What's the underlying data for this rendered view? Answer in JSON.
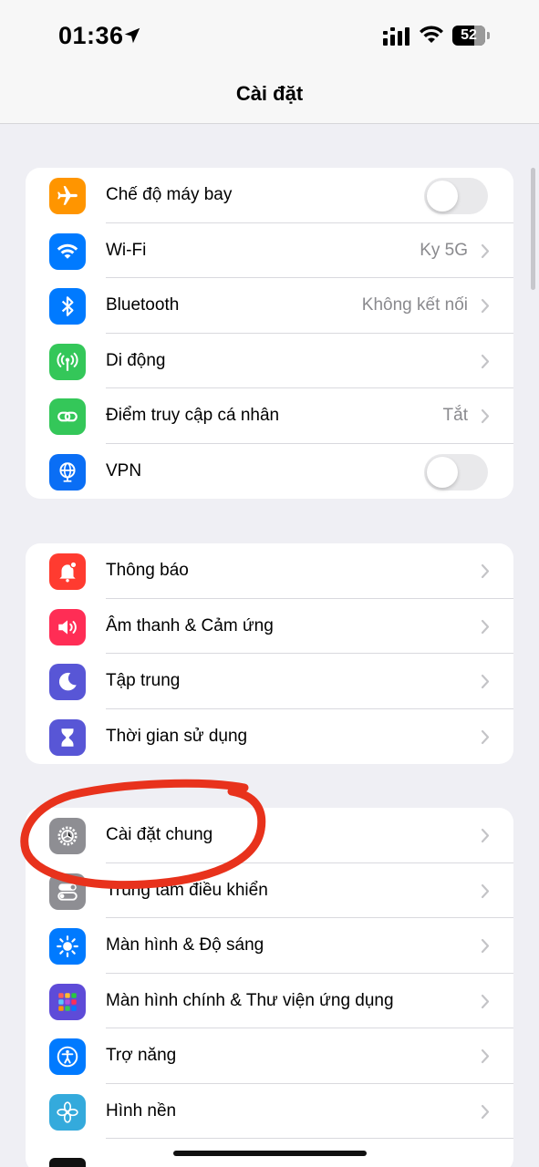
{
  "status_bar": {
    "time": "01:36",
    "battery": "52",
    "icons": [
      "location-arrow-icon",
      "cellular-signal-icon",
      "wifi-icon",
      "battery-icon"
    ]
  },
  "nav": {
    "title": "Cài đặt"
  },
  "groups": [
    {
      "items": [
        {
          "label": "Chế độ máy bay",
          "icon": "airplane-icon",
          "color": "#ff9500",
          "type": "toggle",
          "on": false
        },
        {
          "label": "Wi-Fi",
          "icon": "wifi-icon",
          "color": "#007aff",
          "value": "Ky 5G",
          "type": "link"
        },
        {
          "label": "Bluetooth",
          "icon": "bluetooth-icon",
          "color": "#007aff",
          "value": "Không kết nối",
          "type": "link"
        },
        {
          "label": "Di động",
          "icon": "antenna-icon",
          "color": "#34c759",
          "type": "link"
        },
        {
          "label": "Điểm truy cập cá nhân",
          "icon": "hotspot-link-icon",
          "color": "#34c759",
          "value": "Tắt",
          "type": "link"
        },
        {
          "label": "VPN",
          "icon": "globe-icon",
          "color": "#0a6ef5",
          "type": "toggle",
          "on": false
        }
      ]
    },
    {
      "items": [
        {
          "label": "Thông báo",
          "icon": "bell-icon",
          "color": "#ff3b30",
          "type": "link"
        },
        {
          "label": "Âm thanh & Cảm ứng",
          "icon": "speaker-icon",
          "color": "#ff2d55",
          "type": "link"
        },
        {
          "label": "Tập trung",
          "icon": "moon-icon",
          "color": "#5856d6",
          "type": "link"
        },
        {
          "label": "Thời gian sử dụng",
          "icon": "hourglass-icon",
          "color": "#5856d6",
          "type": "link"
        }
      ]
    },
    {
      "items": [
        {
          "label": "Cài đặt chung",
          "icon": "gear-icon",
          "color": "#8e8e93",
          "type": "link"
        },
        {
          "label": "Trung tâm điều khiển",
          "icon": "toggles-icon",
          "color": "#8e8e93",
          "type": "link"
        },
        {
          "label": "Màn hình & Độ sáng",
          "icon": "sun-icon",
          "color": "#007aff",
          "type": "link"
        },
        {
          "label": "Màn hình chính & Thư viện ứng dụng",
          "icon": "app-grid-icon",
          "color": "#5e4bd8",
          "type": "link"
        },
        {
          "label": "Trợ năng",
          "icon": "accessibility-icon",
          "color": "#007aff",
          "type": "link"
        },
        {
          "label": "Hình nền",
          "icon": "flower-icon",
          "color": "#34aadc",
          "type": "link"
        }
      ]
    }
  ],
  "annotation": {
    "color": "#e8321c"
  }
}
